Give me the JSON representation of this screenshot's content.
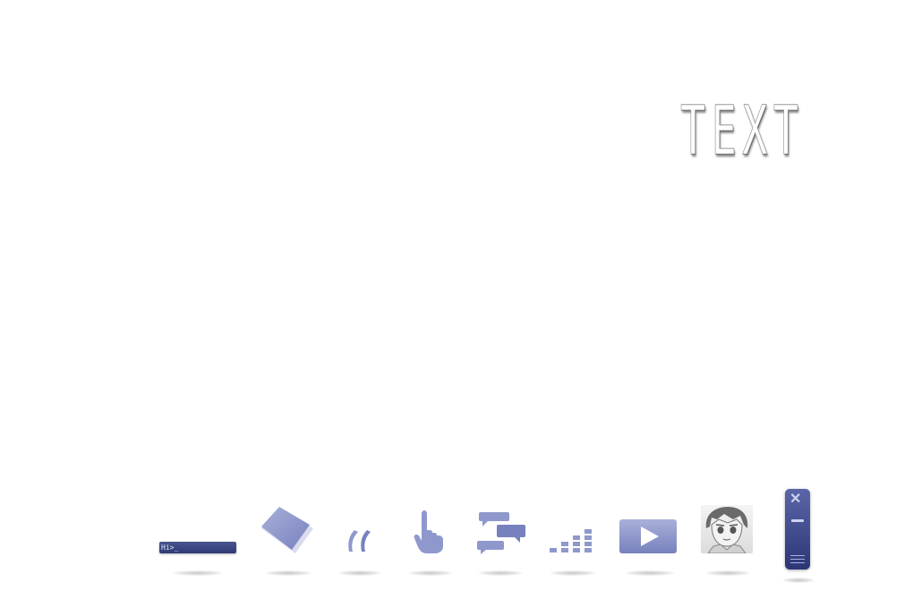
{
  "logo": {
    "text": "TEXT"
  },
  "dock": {
    "console": {
      "prompt": "Hi>_"
    },
    "items": [
      {
        "name": "console",
        "icon": "terminal-icon"
      },
      {
        "name": "notes",
        "icon": "note-icon"
      },
      {
        "name": "quote",
        "icon": "quote-icon"
      },
      {
        "name": "pointer",
        "icon": "hand-pointer-icon"
      },
      {
        "name": "chat",
        "icon": "chat-bubbles-icon"
      },
      {
        "name": "equalizer",
        "icon": "equalizer-icon"
      },
      {
        "name": "video",
        "icon": "play-icon"
      },
      {
        "name": "profile",
        "icon": "avatar-icon"
      },
      {
        "name": "window-controls",
        "icon": "window-panel-icon"
      }
    ],
    "accent": "#3a4585",
    "icon_tint": "#8f98cc"
  }
}
